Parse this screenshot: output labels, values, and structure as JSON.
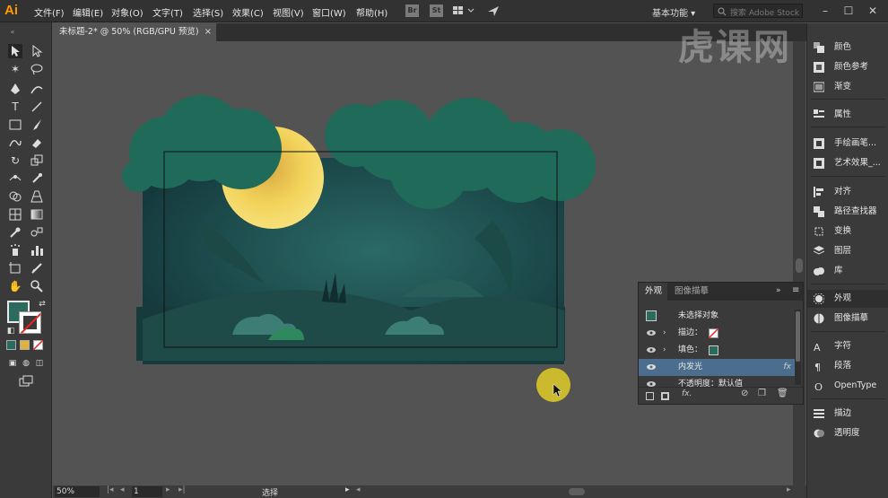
{
  "app": {
    "logo": "Ai"
  },
  "menu": [
    "文件(F)",
    "编辑(E)",
    "对象(O)",
    "文字(T)",
    "选择(S)",
    "效果(C)",
    "视图(V)",
    "窗口(W)",
    "帮助(H)"
  ],
  "menubar_badges": [
    "Br",
    "St"
  ],
  "workspace": "基本功能 ▾",
  "stock_search_placeholder": "搜索 Adobe Stock",
  "document_tab": {
    "title": "未标题-2* @ 50% (RGB/GPU 预览)",
    "close": "×"
  },
  "status": {
    "zoom": "50%",
    "page": "1",
    "mode": "选择"
  },
  "watermark": "虎课网",
  "colors": {
    "fill": "#2a6b5e",
    "moon": "#f2d35a",
    "tree": "#1f6a58",
    "sky": "#1e4a4c",
    "ground": "#173a3b",
    "cursor_highlight": "#d6c32a",
    "panel_selection": "#4b6d8e"
  },
  "dock": [
    {
      "label": "颜色",
      "icon": "color-icon"
    },
    {
      "label": "颜色参考",
      "icon": "color-guide-icon"
    },
    {
      "label": "渐变",
      "icon": "gradient-icon"
    },
    {
      "label": "属性",
      "icon": "properties-icon"
    },
    {
      "label": "手绘画笔...",
      "icon": "brush-library-icon"
    },
    {
      "label": "艺术效果_...",
      "icon": "art-effect-icon"
    },
    {
      "label": "对齐",
      "icon": "align-icon"
    },
    {
      "label": "路径查找器",
      "icon": "pathfinder-icon"
    },
    {
      "label": "变换",
      "icon": "transform-icon"
    },
    {
      "label": "图层",
      "icon": "layers-icon"
    },
    {
      "label": "库",
      "icon": "libraries-icon"
    },
    {
      "label": "外观",
      "icon": "appearance-icon"
    },
    {
      "label": "图像描摹",
      "icon": "image-trace-icon"
    },
    {
      "label": "字符",
      "icon": "character-icon"
    },
    {
      "label": "段落",
      "icon": "paragraph-icon"
    },
    {
      "label": "OpenType",
      "icon": "opentype-icon"
    },
    {
      "label": "描边",
      "icon": "stroke-icon"
    },
    {
      "label": "透明度",
      "icon": "transparency-icon"
    }
  ],
  "appearance_panel": {
    "tabs": [
      "外观",
      "图像描摹"
    ],
    "header_label": "未选择对象",
    "rows": [
      {
        "label": "描边：",
        "expandable": true,
        "has_eye": true
      },
      {
        "label": "填色：",
        "expandable": true,
        "has_eye": true
      },
      {
        "label": "内发光",
        "expandable": false,
        "has_eye": true,
        "fx": "fx"
      },
      {
        "label": "不透明度：默认值",
        "expandable": false,
        "has_eye": true
      }
    ],
    "footer_fx": "fx."
  }
}
